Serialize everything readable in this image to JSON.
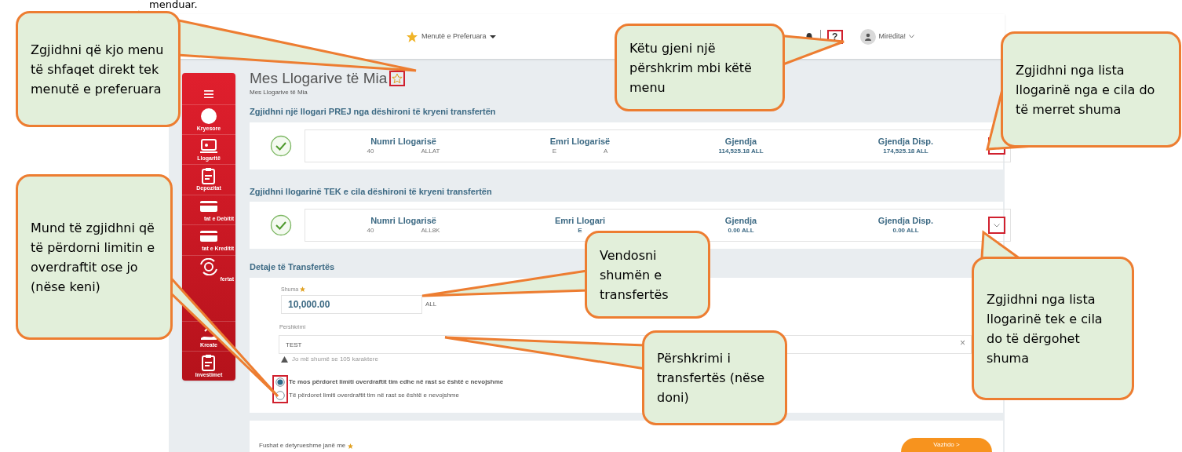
{
  "caption_fragment": "menduar.",
  "header": {
    "favorites_menu": "Menutë e Preferuara",
    "help": "?",
    "greeting": "Mirëdita!"
  },
  "sidebar": {
    "items": [
      {
        "kind": "home",
        "label": "Kryesore"
      },
      {
        "kind": "accounts",
        "label": "Llogaritë"
      },
      {
        "kind": "deposits",
        "label": "Depozitat"
      },
      {
        "kind": "card",
        "label": "tat e Debitit"
      },
      {
        "kind": "card",
        "label": "tat e Kreditit"
      },
      {
        "kind": "transfer",
        "label": "fertat"
      },
      {
        "kind": "loans",
        "label": "Kreate"
      },
      {
        "kind": "deposits",
        "label": "Investimet"
      }
    ]
  },
  "page": {
    "title": "Mes Llogarive të Mia",
    "breadcrumb": "Mes Llogarive të Mia"
  },
  "from_section": {
    "heading": "Zgjidhni një llogari PREJ nga dëshironi të kryeni transfertën",
    "account": {
      "selected": true,
      "columns": [
        {
          "label": "Numri Llogarisë",
          "values": [
            "40",
            "ALLAT"
          ]
        },
        {
          "label": "Emri Llogarisë",
          "values": [
            "E",
            "A"
          ]
        },
        {
          "label": "Gjendja",
          "values": [
            "114,525.18 ALL"
          ]
        },
        {
          "label": "Gjendja Disp.",
          "values": [
            "174,525.18 ALL"
          ]
        }
      ]
    }
  },
  "to_section": {
    "heading": "Zgjidhni llogarinë TEK e cila dëshironi të kryeni transfertën",
    "account": {
      "selected": true,
      "columns": [
        {
          "label": "Numri Llogarisë",
          "values": [
            "40",
            "ALL8K"
          ]
        },
        {
          "label": "Emri Llogari",
          "values": [
            "E"
          ]
        },
        {
          "label": "Gjendja",
          "values": [
            "0.00 ALL"
          ]
        },
        {
          "label": "Gjendja Disp.",
          "values": [
            "0.00 ALL"
          ]
        }
      ]
    }
  },
  "details": {
    "heading": "Detaje të Transfertës",
    "amount_label": "Shuma",
    "amount": "10,000.00",
    "currency": "ALL",
    "description_label": "Pershkrimi",
    "description": "TEST",
    "clear": "×",
    "hint": "Jo më shumë se 105 karaktere",
    "overdraft_options": [
      {
        "label": "Te mos përdoret limiti overdraftit tim edhe në rast se është e nevojshme",
        "selected": true
      },
      {
        "label": "Të përdoret limiti overdraftit tim në rast se është e nevojshme",
        "selected": false
      }
    ]
  },
  "footer": {
    "required_note": "Fushat e detyrueshme janë me",
    "button": "Vazhdo >"
  },
  "callouts": [
    {
      "text": "Zgjidhni që kjo menu të shfaqet direkt tek menutë e preferuara"
    },
    {
      "text": "Këtu gjeni një përshkrim mbi këtë menu"
    },
    {
      "text": "Zgjidhni nga lista llogarinë nga e cila do të merret shuma"
    },
    {
      "text": "Mund të zgjidhni që të përdorni limitin e overdraftit ose jo (nëse keni)"
    },
    {
      "text": "Vendosni shumën e transfertës"
    },
    {
      "text": "Përshkrimi i transfertës (nëse doni)"
    },
    {
      "text": "Zgjidhni nga lista llogarinë tek e cila do të dërgohet shuma"
    }
  ]
}
